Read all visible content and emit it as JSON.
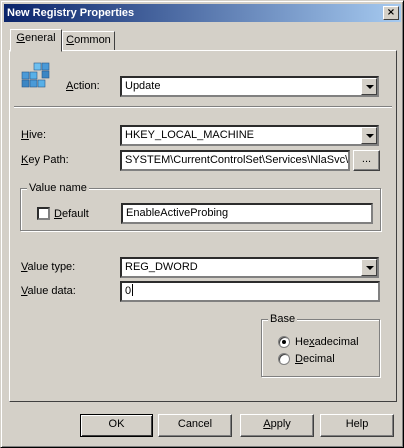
{
  "window": {
    "title": "New Registry Properties",
    "close_glyph": "×"
  },
  "tabs": [
    {
      "label": "General",
      "accel": "G",
      "rest": "eneral"
    },
    {
      "label": "Common",
      "accel": "C",
      "rest": "ommon"
    }
  ],
  "action": {
    "label": "Action:",
    "accel": "A",
    "rest": "ction:",
    "value": "Update"
  },
  "hive": {
    "label": "Hive:",
    "accel": "H",
    "rest": "ive:",
    "value": "HKEY_LOCAL_MACHINE"
  },
  "key_path": {
    "label": "Key Path:",
    "accel": "K",
    "rest": "ey Path:",
    "value": "SYSTEM\\CurrentControlSet\\Services\\NlaSvc\\Pa",
    "browse": "..."
  },
  "value_name": {
    "group_label": "Value name",
    "default_label": "Default",
    "default_accel": "D",
    "default_rest": "efault",
    "default_checked": false,
    "value": "EnableActiveProbing"
  },
  "value_type": {
    "label": "Value type:",
    "accel": "V",
    "rest": "alue type:",
    "value": "REG_DWORD"
  },
  "value_data": {
    "label": "Value data:",
    "accel": "V",
    "rest": "alue data:",
    "value": "0"
  },
  "base": {
    "group_label": "Base",
    "options": [
      {
        "label": "Hexadecimal",
        "pre": "He",
        "accel": "x",
        "rest": "adecimal",
        "checked": true
      },
      {
        "label": "Decimal",
        "pre": "",
        "accel": "D",
        "rest": "ecimal",
        "checked": false
      }
    ]
  },
  "buttons": {
    "ok": "OK",
    "cancel": "Cancel",
    "apply": {
      "label": "Apply",
      "accel": "A",
      "rest": "pply"
    },
    "help": "Help"
  }
}
